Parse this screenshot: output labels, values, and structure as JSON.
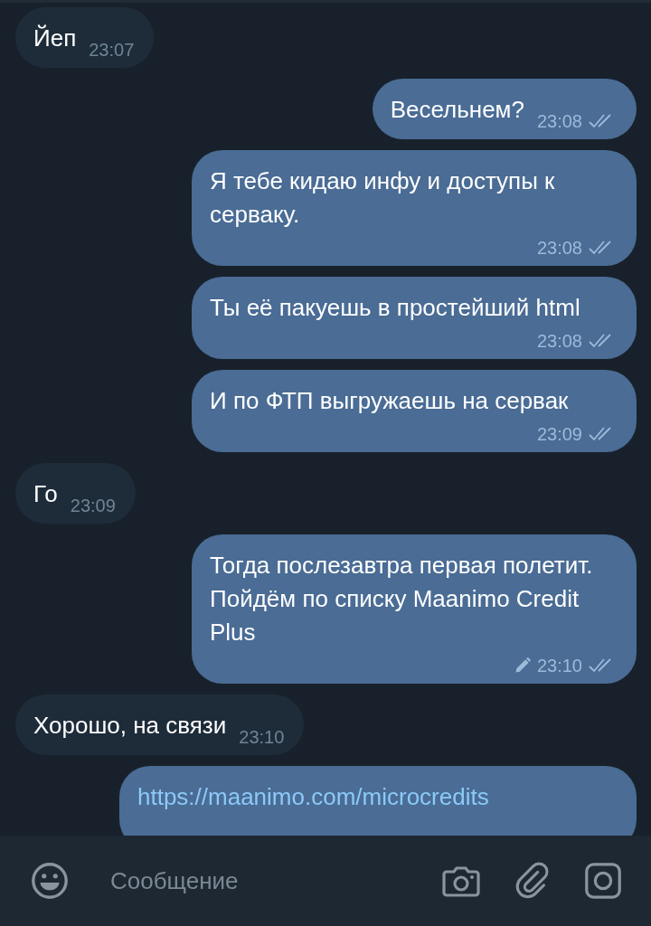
{
  "messages": [
    {
      "outgoing": false,
      "kind": "text",
      "text": "Йеп",
      "time": "23:07",
      "edited": false
    },
    {
      "outgoing": true,
      "kind": "text",
      "text": "Весельнем?",
      "time": "23:08",
      "read": true,
      "edited": false
    },
    {
      "outgoing": true,
      "kind": "text",
      "text": "Я тебе кидаю инфу и доступы к серваку.",
      "time": "23:08",
      "read": true,
      "edited": false
    },
    {
      "outgoing": true,
      "kind": "text",
      "text": "Ты её пакуешь в простейший html",
      "time": "23:08",
      "read": true,
      "edited": false
    },
    {
      "outgoing": true,
      "kind": "text",
      "text": "И по ФТП выгружаешь на сервак",
      "time": "23:09",
      "read": true,
      "edited": false
    },
    {
      "outgoing": false,
      "kind": "text",
      "text": "Го",
      "time": "23:09",
      "edited": false
    },
    {
      "outgoing": true,
      "kind": "text",
      "text": "Тогда послезавтра первая полетит. Пойдём по списку Maanimo Credit Plus",
      "time": "23:10",
      "read": true,
      "edited": true
    },
    {
      "outgoing": false,
      "kind": "text",
      "text": "Хорошо, на связи",
      "time": "23:10",
      "edited": false
    },
    {
      "outgoing": true,
      "kind": "link",
      "text": "https://maanimo.com/microcredits"
    }
  ],
  "composer": {
    "placeholder": "Сообщение"
  }
}
